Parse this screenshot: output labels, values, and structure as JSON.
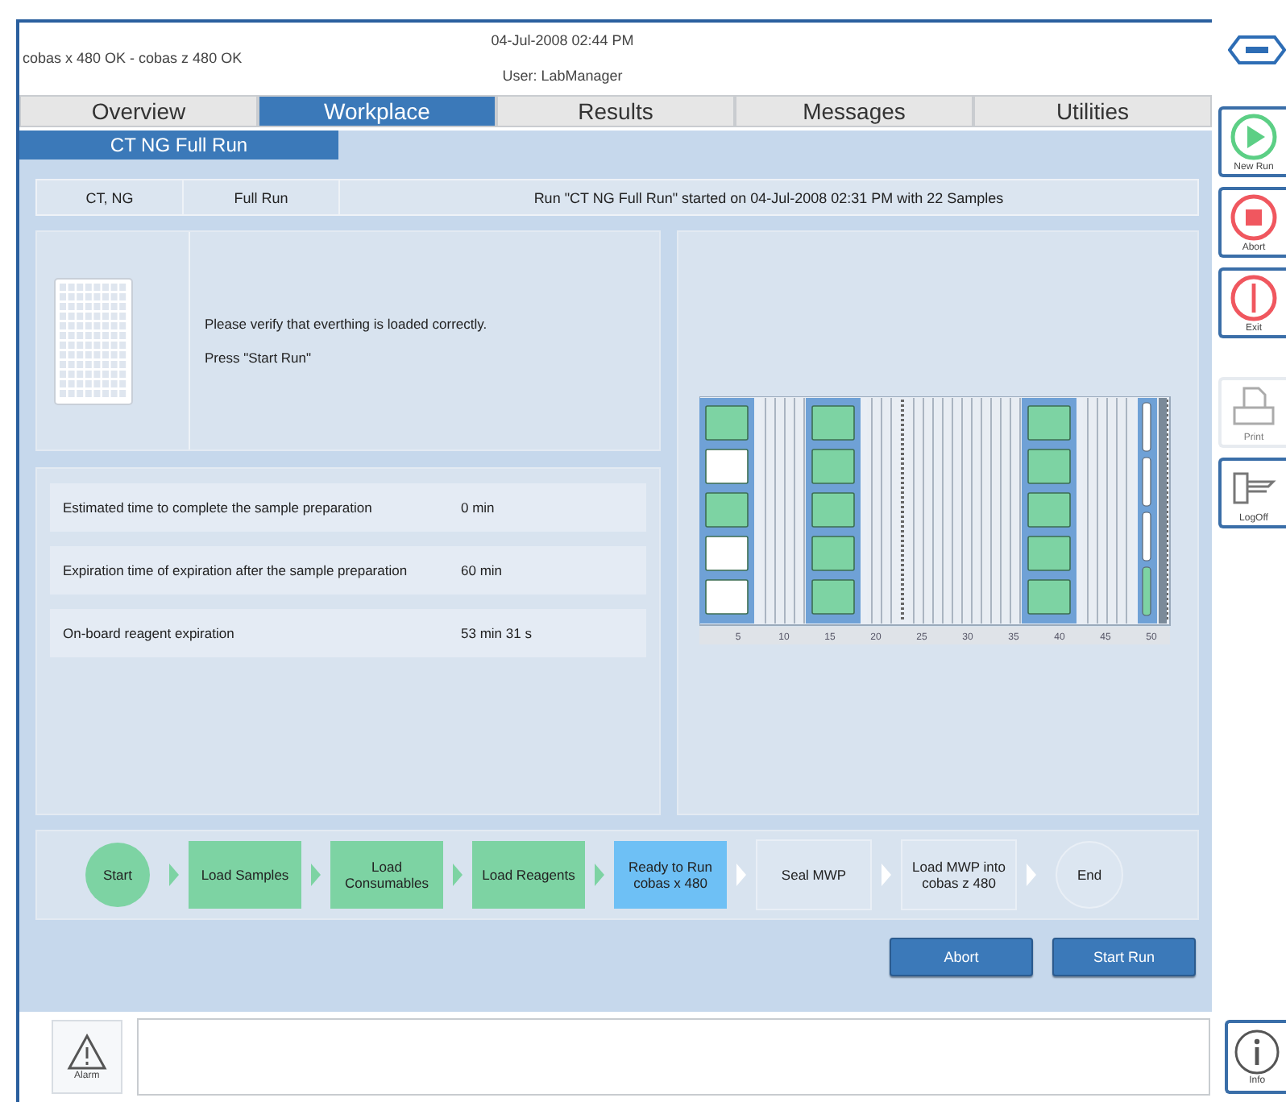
{
  "header": {
    "status": "cobas x 480 OK - cobas z 480 OK",
    "datetime": "04-Jul-2008 02:44 PM",
    "user": "User: LabManager"
  },
  "tabs": [
    {
      "label": "Overview",
      "selected": false
    },
    {
      "label": "Workplace",
      "selected": true
    },
    {
      "label": "Results",
      "selected": false
    },
    {
      "label": "Messages",
      "selected": false
    },
    {
      "label": "Utilities",
      "selected": false
    }
  ],
  "subtabs": [
    {
      "label": "CT NG Full Run",
      "selected": true
    }
  ],
  "run_info": {
    "targets": "CT, NG",
    "run_type": "Full Run",
    "message": "Run \"CT NG Full Run\" started on 04-Jul-2008 02:31 PM with 22 Samples"
  },
  "instructions": [
    "Please verify that everthing is loaded correctly.",
    "Press \"Start Run\""
  ],
  "timings": [
    {
      "label": "Estimated time to complete the sample preparation",
      "value": "0 min"
    },
    {
      "label": "Expiration time of expiration after the sample preparation",
      "value": "60 min"
    },
    {
      "label": "On-board reagent expiration",
      "value": "53 min 31 s"
    }
  ],
  "deck": {
    "carriers": [
      {
        "kind": "plate",
        "slots": [
          {
            "loaded": true
          },
          {
            "loaded": false
          },
          {
            "loaded": true
          },
          {
            "loaded": false
          },
          {
            "loaded": false
          }
        ]
      },
      {
        "kind": "plate",
        "slots": [
          {
            "loaded": true
          },
          {
            "loaded": true
          },
          {
            "loaded": true
          },
          {
            "loaded": true
          },
          {
            "loaded": true
          }
        ]
      },
      {
        "kind": "plate",
        "slots": [
          {
            "loaded": true
          },
          {
            "loaded": true
          },
          {
            "loaded": true
          },
          {
            "loaded": true
          },
          {
            "loaded": true
          }
        ]
      },
      {
        "kind": "reagent",
        "slots": [
          {
            "loaded": false
          },
          {
            "loaded": false
          },
          {
            "loaded": false
          },
          {
            "loaded": true
          }
        ]
      }
    ],
    "ticks": [
      "5",
      "10",
      "15",
      "20",
      "25",
      "30",
      "35",
      "40",
      "45",
      "50"
    ]
  },
  "workflow": [
    {
      "label": "Start",
      "kind": "circle",
      "completed": true,
      "selected": false
    },
    {
      "label": "Load Samples",
      "kind": "box",
      "completed": true,
      "selected": false
    },
    {
      "label": "Load Consumables",
      "kind": "box",
      "completed": true,
      "selected": false
    },
    {
      "label": "Load Reagents",
      "kind": "box",
      "completed": true,
      "selected": false
    },
    {
      "label": "Ready to Run cobas x 480",
      "kind": "box",
      "completed": false,
      "selected": true
    },
    {
      "label": "Seal MWP",
      "kind": "box",
      "completed": false,
      "selected": false
    },
    {
      "label": "Load MWP into cobas z 480",
      "kind": "box",
      "completed": false,
      "selected": false
    },
    {
      "label": "End",
      "kind": "circle",
      "completed": false,
      "selected": false
    }
  ],
  "actions": [
    "Abort",
    "Start Run"
  ],
  "side_buttons": [
    {
      "label": "New Run",
      "kind": "play",
      "disabled": false
    },
    {
      "label": "Abort",
      "kind": "stop",
      "disabled": false
    },
    {
      "label": "Exit",
      "kind": "exit",
      "disabled": false
    },
    {
      "label": "Print",
      "kind": "print",
      "disabled": true
    },
    {
      "label": "LogOff",
      "kind": "key",
      "disabled": false
    }
  ],
  "bottom": {
    "alarm": "Alarm",
    "info": "Info"
  }
}
